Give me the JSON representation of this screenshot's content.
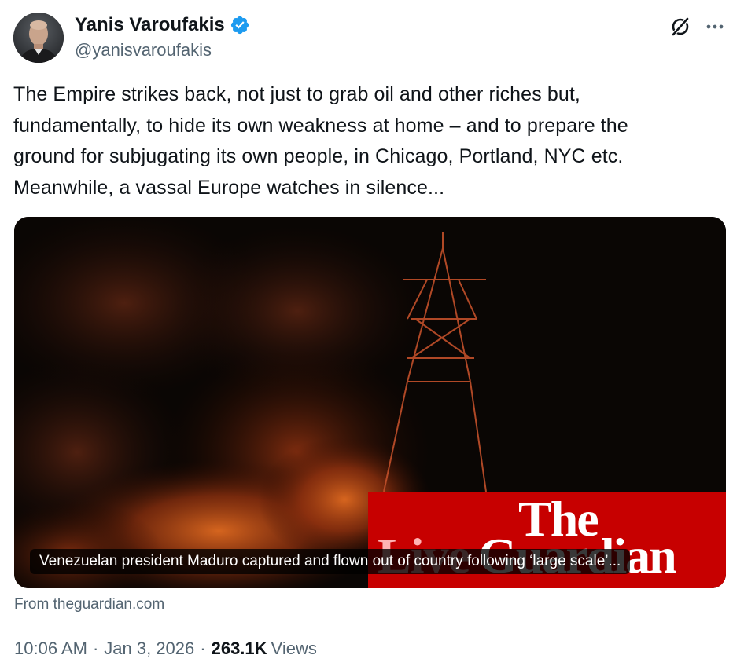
{
  "author": {
    "name": "Yanis Varoufakis",
    "handle": "@yanisvaroufakis",
    "verified": true,
    "verified_color": "#1d9bf0"
  },
  "tweet": {
    "text": "The Empire strikes back, not just to grab oil and other riches but,\nfundamentally, to hide its own weakness at home – and to prepare the\nground for subjugating its own people, in Chicago, Portland, NYC etc.\nMeanwhile, a vassal Europe watches in silence..."
  },
  "card": {
    "headline": "Venezuelan president Maduro captured and flown out of country following ‘large scale’...",
    "source": "From theguardian.com",
    "logo_text": {
      "the": "The",
      "live": "Live",
      "name": "Guardian"
    },
    "brand_color": "#c70000"
  },
  "meta": {
    "time": "10:06 AM",
    "separator": "·",
    "date": "Jan 3, 2026",
    "views_count": "263.1K",
    "views_label": "Views"
  },
  "icons": {
    "grok": "grok-icon",
    "more": "more-horizontal-icon",
    "verified": "verified-badge-icon"
  },
  "colors": {
    "text_primary": "#0f1419",
    "text_secondary": "#536471"
  }
}
